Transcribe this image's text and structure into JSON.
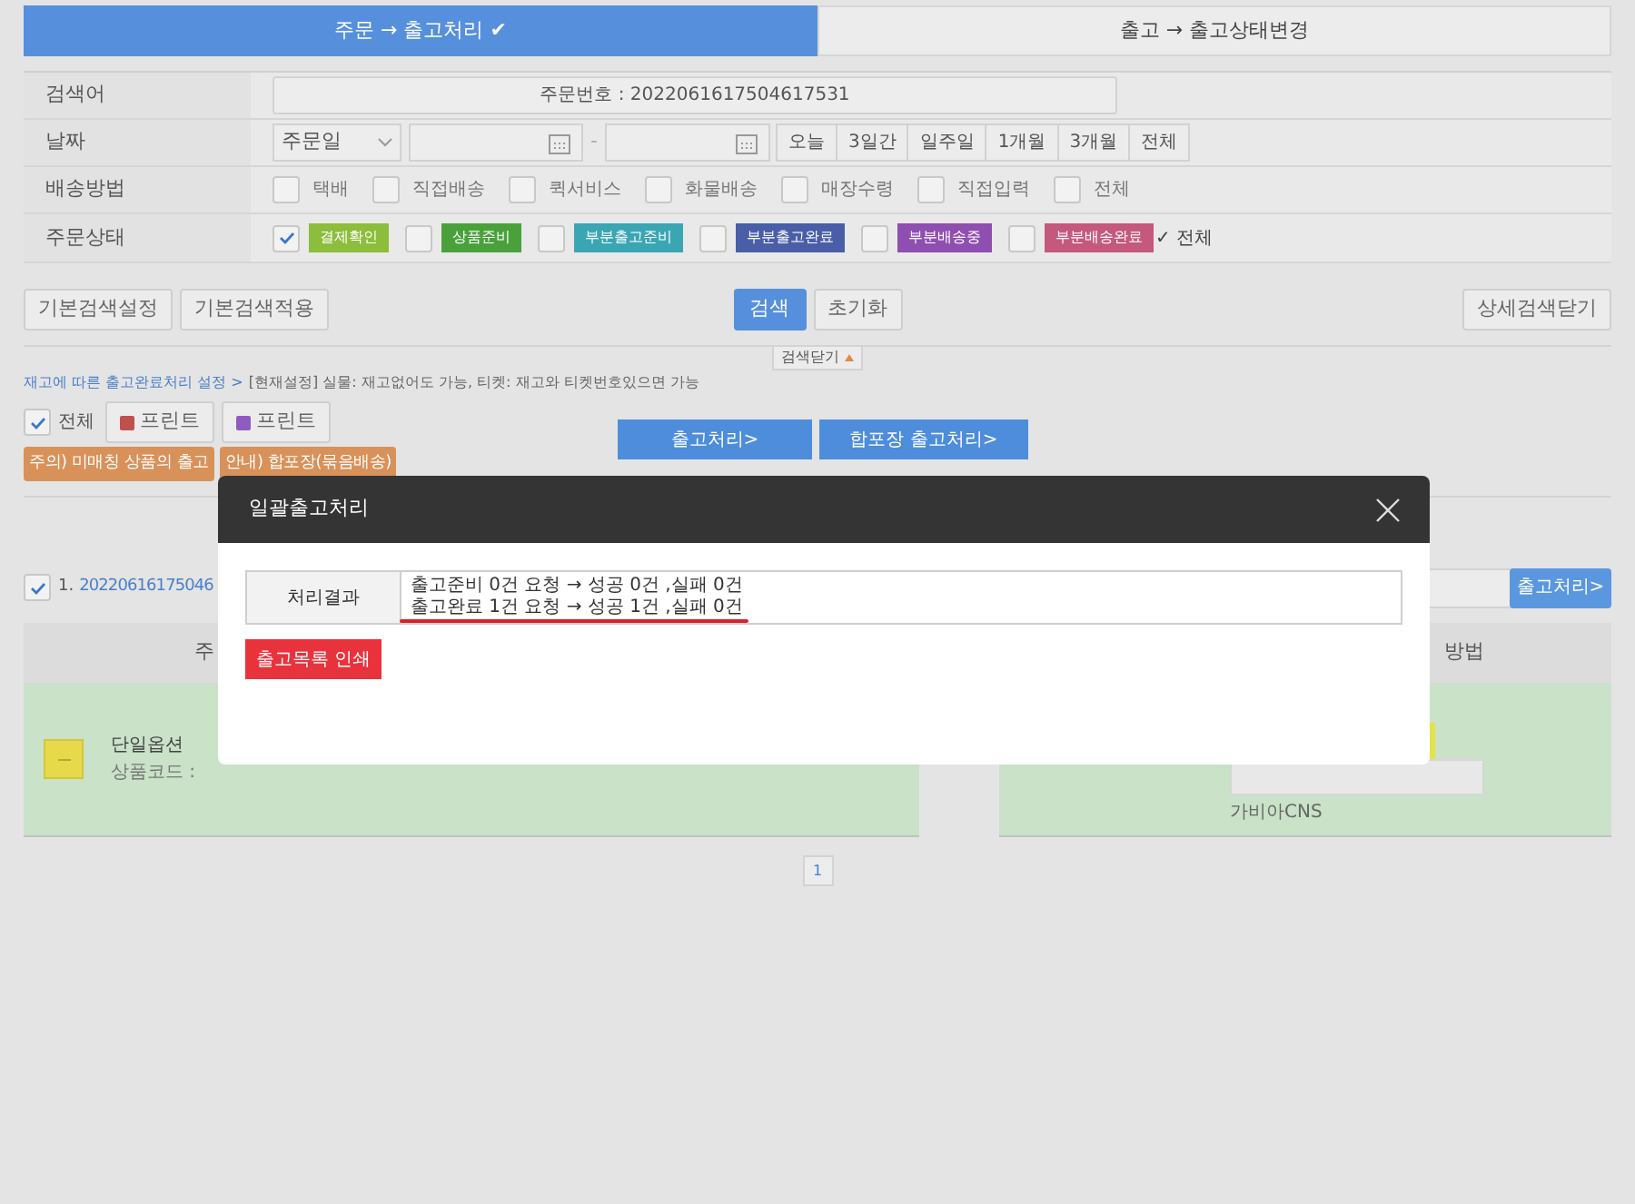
{
  "tabs": [
    {
      "label": "주문 → 출고처리 ✔",
      "selected": true
    },
    {
      "label": "출고 → 출고상태변경",
      "selected": false
    }
  ],
  "search": {
    "keyword": {
      "label": "검색어",
      "value": "주문번호 : 2022061617504617531"
    },
    "date": {
      "label": "날짜",
      "select": "주문일",
      "separator": "-",
      "ranges": [
        "오늘",
        "3일간",
        "일주일",
        "1개월",
        "3개월",
        "전체"
      ]
    },
    "shipping": {
      "label": "배송방법",
      "options": [
        {
          "label": "택배",
          "checked": false
        },
        {
          "label": "직접배송",
          "checked": false
        },
        {
          "label": "퀵서비스",
          "checked": false
        },
        {
          "label": "화물배송",
          "checked": false
        },
        {
          "label": "매장수령",
          "checked": false
        },
        {
          "label": "직접입력",
          "checked": false
        },
        {
          "label": "전체",
          "checked": false
        }
      ]
    },
    "status": {
      "label": "주문상태",
      "options": [
        {
          "label": "결제확인",
          "checked": true,
          "color": "#8cbd3c"
        },
        {
          "label": "상품준비",
          "checked": false,
          "color": "#4aa13c"
        },
        {
          "label": "부분출고준비",
          "checked": false,
          "color": "#3ba6b3"
        },
        {
          "label": "부분출고완료",
          "checked": false,
          "color": "#4a5ea8"
        },
        {
          "label": "부분배송중",
          "checked": false,
          "color": "#8e4fb0"
        },
        {
          "label": "부분배송완료",
          "checked": false,
          "color": "#c4587d"
        }
      ],
      "all": "✓ 전체"
    }
  },
  "search_buttons": {
    "left": [
      "기본검색설정",
      "기본검색적용"
    ],
    "search": "검색",
    "reset": "초기화",
    "right": "상세검색닫기"
  },
  "toggle": "검색닫기",
  "notice": {
    "link": "재고에 따른 출고완료처리 설정 >",
    "text": "[현재설정] 실물: 재고없어도 가능,  티켓: 재고와 티켓번호있으면 가능"
  },
  "actions": {
    "all": {
      "label": "전체",
      "checked": true
    },
    "prints": [
      {
        "label": "프린트",
        "color": "#c0504d"
      },
      {
        "label": "프린트",
        "color": "#8e5cc0"
      }
    ],
    "process": [
      "출고처리>",
      "합포장 출고처리>"
    ],
    "notes": [
      "주의) 미매칭 상품의 출고",
      "안내) 합포장(묶음배송)"
    ]
  },
  "order": {
    "checked": true,
    "number": "1.",
    "id": "20220616175046",
    "button": "출고처리>"
  },
  "table": {
    "header": [
      "주",
      "방법"
    ],
    "rows": [
      {
        "option": "단일옵션",
        "code": "상품코드 :",
        "courier": "가비아CNS"
      }
    ]
  },
  "pagination": [
    "1"
  ],
  "modal": {
    "title": "일괄출고처리",
    "label": "처리결과",
    "lines": [
      "출고준비 0건 요청 → 성공 0건 ,실패 0건",
      "출고완료 1건 요청 → 성공 1건 ,실패 0건"
    ],
    "print": "출고목록 인쇄"
  }
}
